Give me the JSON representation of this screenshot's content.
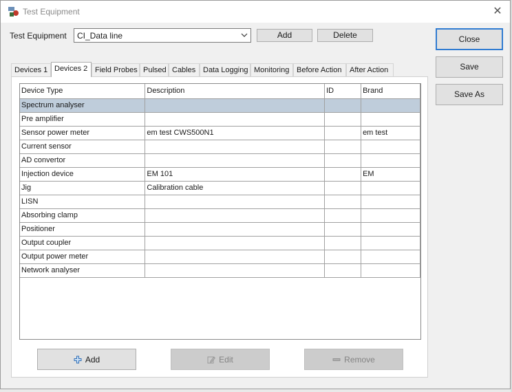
{
  "window": {
    "title": "Test Equipment"
  },
  "top": {
    "label": "Test Equipment",
    "selected": "CI_Data line",
    "add_label": "Add",
    "delete_label": "Delete"
  },
  "side": {
    "close": "Close",
    "save": "Save",
    "save_as": "Save As"
  },
  "tabs": [
    "Devices 1",
    "Devices 2",
    "Field Probes",
    "Pulsed",
    "Cables",
    "Data Logging",
    "Monitoring",
    "Before Action",
    "After Action"
  ],
  "active_tab": "Devices 2",
  "table": {
    "headers": [
      "Device Type",
      "Description",
      "ID",
      "Brand"
    ],
    "rows": [
      [
        "Spectrum analyser",
        "",
        "",
        ""
      ],
      [
        "Pre amplifier",
        "",
        "",
        ""
      ],
      [
        "Sensor power meter",
        "em test CWS500N1",
        "",
        "em test"
      ],
      [
        "Current sensor",
        "",
        "",
        ""
      ],
      [
        "AD convertor",
        "",
        "",
        ""
      ],
      [
        "Injection device",
        "EM 101",
        "",
        "EM"
      ],
      [
        "Jig",
        "Calibration cable",
        "",
        ""
      ],
      [
        "LISN",
        "",
        "",
        ""
      ],
      [
        "Absorbing clamp",
        "",
        "",
        ""
      ],
      [
        "Positioner",
        "",
        "",
        ""
      ],
      [
        "Output coupler",
        "",
        "",
        ""
      ],
      [
        "Output power meter",
        "",
        "",
        ""
      ],
      [
        "Network analyser",
        "",
        "",
        ""
      ]
    ]
  },
  "bottom": {
    "add": "Add",
    "edit": "Edit",
    "remove": "Remove"
  },
  "colors": {
    "selected_row": "#bfcddb",
    "default_button_border": "#2f7bd1"
  }
}
